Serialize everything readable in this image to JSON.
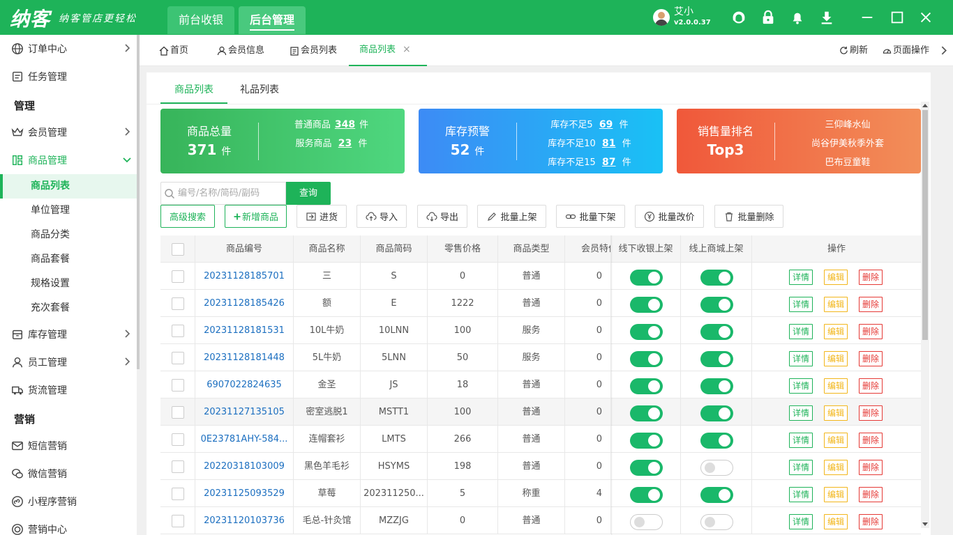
{
  "app": {
    "logo": "纳客",
    "slogan": "纳客管店更轻松",
    "top_tabs": [
      "前台收银",
      "后台管理"
    ],
    "user_name": "艾小",
    "version": "v2.0.0.37"
  },
  "sidebar": {
    "items": [
      {
        "label": "订单中心",
        "icon": "globe-icon"
      },
      {
        "label": "任务管理",
        "icon": "task-icon"
      },
      {
        "label": "管理",
        "type": "section"
      },
      {
        "label": "会员管理",
        "icon": "crown-icon"
      },
      {
        "label": "商品管理",
        "icon": "grid-icon"
      },
      {
        "label": "库存管理",
        "icon": "box-icon"
      },
      {
        "label": "员工管理",
        "icon": "person-icon"
      },
      {
        "label": "货流管理",
        "icon": "truck-icon"
      },
      {
        "label": "营销",
        "type": "section"
      },
      {
        "label": "短信营销",
        "icon": "mail-icon"
      },
      {
        "label": "微信营销",
        "icon": "wechat-icon"
      },
      {
        "label": "小程序营销",
        "icon": "miniapp-icon"
      },
      {
        "label": "营销中心",
        "icon": "target-icon"
      }
    ],
    "sub_items": [
      "商品列表",
      "单位管理",
      "商品分类",
      "商品套餐",
      "规格设置",
      "充次套餐"
    ]
  },
  "page_tabs": [
    "首页",
    "会员信息",
    "会员列表",
    "商品列表"
  ],
  "tab_actions": {
    "refresh": "刷新",
    "page_ops": "页面操作"
  },
  "sub_tabs": [
    "商品列表",
    "礼品列表"
  ],
  "cards": {
    "total": {
      "title": "商品总量",
      "value": "371",
      "unit": "件",
      "lines": [
        {
          "label": "普通商品",
          "num": "348",
          "unit": "件"
        },
        {
          "label": "服务商品",
          "num": "23",
          "unit": "件"
        }
      ]
    },
    "stock": {
      "title": "库存预警",
      "value": "52",
      "unit": "件",
      "lines": [
        {
          "label": "库存不足5",
          "num": "69",
          "unit": "件"
        },
        {
          "label": "库存不足10",
          "num": "81",
          "unit": "件"
        },
        {
          "label": "库存不足15",
          "num": "87",
          "unit": "件"
        }
      ]
    },
    "sales": {
      "title": "销售量排名",
      "value": "Top3",
      "lines": [
        "三仰峰水仙",
        "尚谷伊美秋季外套",
        "巴布豆童鞋"
      ]
    }
  },
  "search": {
    "placeholder": "编号/名称/简码/副码",
    "button": "查询"
  },
  "toolbar": {
    "advanced": "高级搜索",
    "add": "新增商品",
    "stockin": "进货",
    "import": "导入",
    "export": "导出",
    "bulk_on": "批量上架",
    "bulk_off": "批量下架",
    "bulk_price": "批量改价",
    "bulk_delete": "批量删除"
  },
  "table": {
    "headers": [
      "商品编号",
      "商品名称",
      "商品简码",
      "零售价格",
      "商品类型",
      "会员特价",
      "线下收银上架",
      "线上商城上架",
      "操作"
    ],
    "ops": {
      "detail": "详情",
      "edit": "编辑",
      "delete": "删除"
    },
    "rows": [
      {
        "code": "20231128185701",
        "name": "三",
        "short": "S",
        "price": "0",
        "type": "普通",
        "member": "0",
        "offline": true,
        "online": true
      },
      {
        "code": "20231128185426",
        "name": "额",
        "short": "E",
        "price": "1222",
        "type": "普通",
        "member": "0",
        "offline": true,
        "online": true
      },
      {
        "code": "20231128181531",
        "name": "10L牛奶",
        "short": "10LNN",
        "price": "100",
        "type": "服务",
        "member": "0",
        "offline": true,
        "online": true
      },
      {
        "code": "20231128181448",
        "name": "5L牛奶",
        "short": "5LNN",
        "price": "50",
        "type": "服务",
        "member": "0",
        "offline": true,
        "online": true
      },
      {
        "code": "6907022824635",
        "name": "金圣",
        "short": "JS",
        "price": "18",
        "type": "普通",
        "member": "0",
        "offline": true,
        "online": true
      },
      {
        "code": "20231127135105",
        "name": "密室逃脱1",
        "short": "MSTT1",
        "price": "100",
        "type": "普通",
        "member": "0",
        "offline": true,
        "online": true
      },
      {
        "code": "0E23781AHY-584...",
        "name": "连帽套衫",
        "short": "LMTS",
        "price": "266",
        "type": "普通",
        "member": "0",
        "offline": true,
        "online": true
      },
      {
        "code": "20220318103009",
        "name": "黑色羊毛衫",
        "short": "HSYMS",
        "price": "198",
        "type": "普通",
        "member": "0",
        "offline": true,
        "online": false
      },
      {
        "code": "20231125093529",
        "name": "草莓",
        "short": "202311250...",
        "price": "5",
        "type": "称重",
        "member": "4",
        "offline": true,
        "online": true
      },
      {
        "code": "20231120103736",
        "name": "毛总-针灸馆",
        "short": "MZZJG",
        "price": "0",
        "type": "普通",
        "member": "0",
        "offline": false,
        "online": false
      }
    ]
  },
  "colors": {
    "brand": "#1eb359",
    "link": "#1c6fc0",
    "warning": "#f2b61a",
    "danger": "#e53935"
  }
}
